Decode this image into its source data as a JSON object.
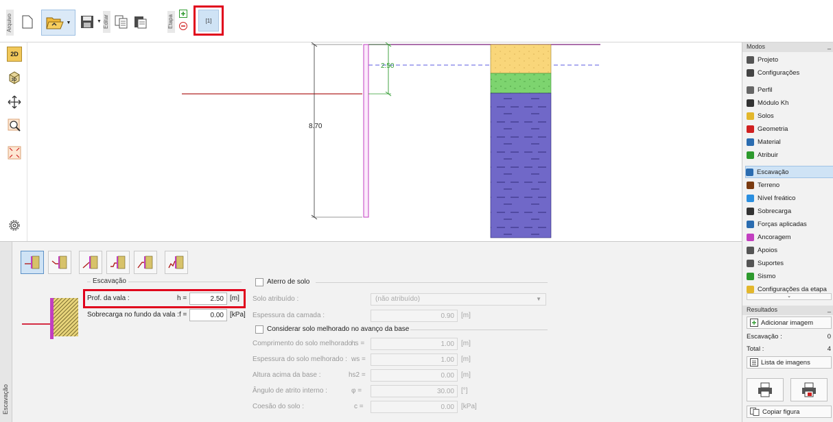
{
  "toolbar": {
    "groups": {
      "arquivo": "Arquivo",
      "editar": "Editar",
      "etapa": "Etapa"
    },
    "stage_label": "[1]"
  },
  "drawing": {
    "depth_label": "8.70",
    "water_label": "2.50"
  },
  "bottom": {
    "side_tab": "Escavação",
    "escavacao_group": "Escavação",
    "prof_label": "Prof. da vala :",
    "prof_symbol": "h =",
    "prof_value": "2.50",
    "prof_unit": "[m]",
    "sobrecarga_label": "Sobrecarga no fundo da vala :",
    "sobrecarga_symbol": "f =",
    "sobrecarga_value": "0.00",
    "sobrecarga_unit": "[kPa]",
    "aterro_group": "Aterro de solo",
    "solo_atribuido_label": "Solo atribuído :",
    "solo_atribuido_value": "(não atribuído)",
    "espessura_camada_label": "Espessura da camada :",
    "espessura_camada_value": "0.90",
    "espessura_camada_unit": "[m]",
    "considerar_label": "Considerar solo melhorado no avanço da base",
    "comprimento_label": "Comprimento do solo melhorado :",
    "comprimento_symbol": "hs =",
    "comprimento_value": "1.00",
    "comprimento_unit": "[m]",
    "espessura_melhorado_label": "Espessura do solo melhorado :",
    "espessura_melhorado_symbol": "ws =",
    "espessura_melhorado_value": "1.00",
    "espessura_melhorado_unit": "[m]",
    "altura_label": "Altura acima da base :",
    "altura_symbol": "hs2 =",
    "altura_value": "0.00",
    "altura_unit": "[m]",
    "angulo_label": "Ângulo de atrito interno :",
    "angulo_symbol": "φ =",
    "angulo_value": "30.00",
    "angulo_unit": "[°]",
    "coesao_label": "Coesão do solo :",
    "coesao_symbol": "c =",
    "coesao_value": "0.00",
    "coesao_unit": "[kPa]"
  },
  "right_panel": {
    "modos_title": "Modos",
    "modos_items": [
      {
        "label": "Projeto",
        "icon": "document-icon"
      },
      {
        "label": "Configurações",
        "icon": "gear-icon"
      },
      {
        "label": "Perfil",
        "icon": "profile-icon"
      },
      {
        "label": "Módulo Kh",
        "icon": "kh-icon"
      },
      {
        "label": "Solos",
        "icon": "soil-icon"
      },
      {
        "label": "Geometria",
        "icon": "geometry-icon"
      },
      {
        "label": "Material",
        "icon": "material-icon"
      },
      {
        "label": "Atribuir",
        "icon": "assign-icon"
      },
      {
        "label": "Escavação",
        "icon": "excavation-icon"
      },
      {
        "label": "Terreno",
        "icon": "terrain-icon"
      },
      {
        "label": "Nível freático",
        "icon": "water-table-icon"
      },
      {
        "label": "Sobrecarga",
        "icon": "surcharge-icon"
      },
      {
        "label": "Forças aplicadas",
        "icon": "applied-forces-icon"
      },
      {
        "label": "Ancoragem",
        "icon": "anchor-icon"
      },
      {
        "label": "Apoios",
        "icon": "props-icon"
      },
      {
        "label": "Suportes",
        "icon": "supports-icon"
      },
      {
        "label": "Sismo",
        "icon": "earthquake-icon"
      },
      {
        "label": "Configurações da etapa",
        "icon": "stage-settings-icon"
      }
    ],
    "resultados_title": "Resultados",
    "adicionar_imagem": "Adicionar imagem",
    "escavacao_label": "Escavação :",
    "escavacao_value": "0",
    "total_label": "Total :",
    "total_value": "4",
    "lista_imagens": "Lista de imagens",
    "copiar_figura": "Copiar figura"
  },
  "colors": {
    "accent_red": "#e0001b",
    "sand": "#f9d67a",
    "green_soil": "#7dd46f",
    "clay_blue": "#7068c8",
    "wall_pink": "#c23fc0",
    "selection_blue": "#cfe3f5"
  }
}
